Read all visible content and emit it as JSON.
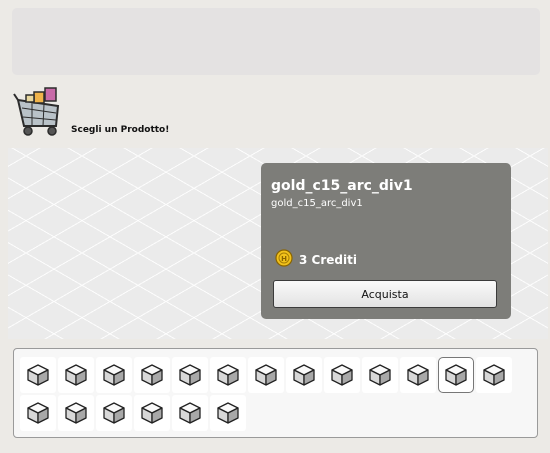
{
  "header": {
    "title": "Scegli un Prodotto!",
    "icon": "shopping-cart-icon"
  },
  "product": {
    "name": "gold_c15_arc_div1",
    "subtitle": "gold_c15_arc_div1",
    "price": "3 Crediti",
    "price_icon": "credit-coin-icon",
    "buy_label": "Acquista"
  },
  "grid": {
    "item_icon": "furniture-cube-icon",
    "items": [
      {
        "selected": false
      },
      {
        "selected": false
      },
      {
        "selected": false
      },
      {
        "selected": false
      },
      {
        "selected": false
      },
      {
        "selected": false
      },
      {
        "selected": false
      },
      {
        "selected": false
      },
      {
        "selected": false
      },
      {
        "selected": false
      },
      {
        "selected": false
      },
      {
        "selected": true
      },
      {
        "selected": false
      },
      {
        "selected": false
      },
      {
        "selected": false
      },
      {
        "selected": false
      },
      {
        "selected": false
      },
      {
        "selected": false
      },
      {
        "selected": false
      }
    ]
  },
  "colors": {
    "info_box_bg": "#7d7d79",
    "coin": "#f2c21b"
  }
}
